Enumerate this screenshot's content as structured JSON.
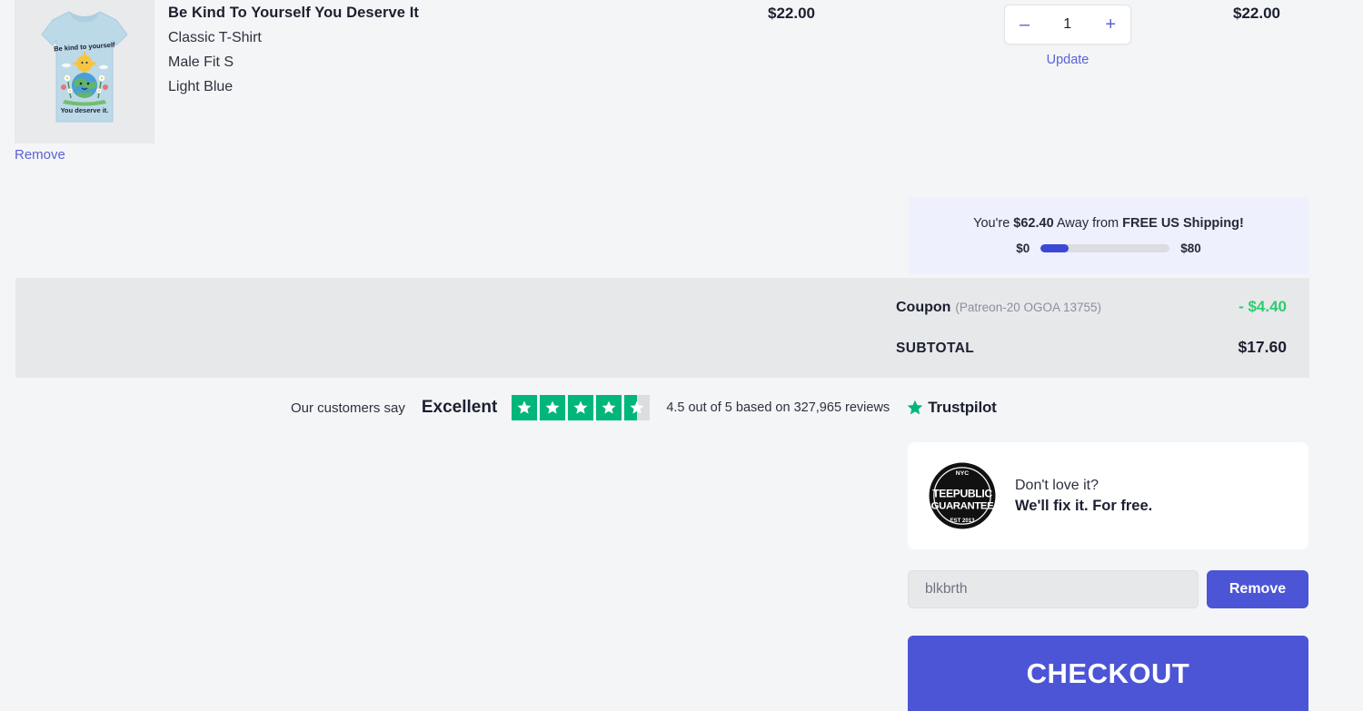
{
  "cart_item": {
    "title": "Be Kind To Yourself You Deserve It",
    "product_type": "Classic T-Shirt",
    "fit_size": "Male Fit S",
    "color": "Light Blue",
    "unit_price": "$22.00",
    "line_total": "$22.00",
    "quantity": "1",
    "decrease_label": "–",
    "increase_label": "+",
    "update_label": "Update",
    "remove_label": "Remove",
    "thumb_design": {
      "shirt_color": "#bcd9e8",
      "top_text": "Be kind to yourself",
      "bottom_text": "You deserve it."
    }
  },
  "free_shipping": {
    "prefix": "You're ",
    "amount_away": "$62.40",
    "middle": " Away from ",
    "goal": "FREE US Shipping!",
    "min_label": "$0",
    "max_label": "$80",
    "progress_percent": 22,
    "fill_color": "#3b48d4",
    "panel_color": "#eef0fd"
  },
  "totals": {
    "coupon_label": "Coupon",
    "coupon_code": "(Patreon-20 OGOA 13755)",
    "coupon_amount": "- $4.40",
    "coupon_amount_color": "#2ecc71",
    "subtotal_label": "SUBTOTAL",
    "subtotal_amount": "$17.60"
  },
  "trustpilot": {
    "prefix": "Our customers say",
    "rating_word": "Excellent",
    "summary": "4.5 out of 5 based on 327,965 reviews",
    "brand": "Trustpilot",
    "stars_filled": 4.5,
    "star_color": "#00b67a",
    "star_empty_color": "#dcdde1"
  },
  "guarantee": {
    "badge_top": "NYC",
    "badge_line1": "TEEPUBLIC",
    "badge_line2": "GUARANTEE",
    "badge_bottom": "EST 2013",
    "line1": "Don't love it?",
    "line2": "We'll fix it. For free."
  },
  "coupon_form": {
    "value": "blkbrth",
    "placeholder": "blkbrth",
    "remove_label": "Remove"
  },
  "checkout": {
    "label": "CHECKOUT",
    "color": "#4c55d6"
  }
}
